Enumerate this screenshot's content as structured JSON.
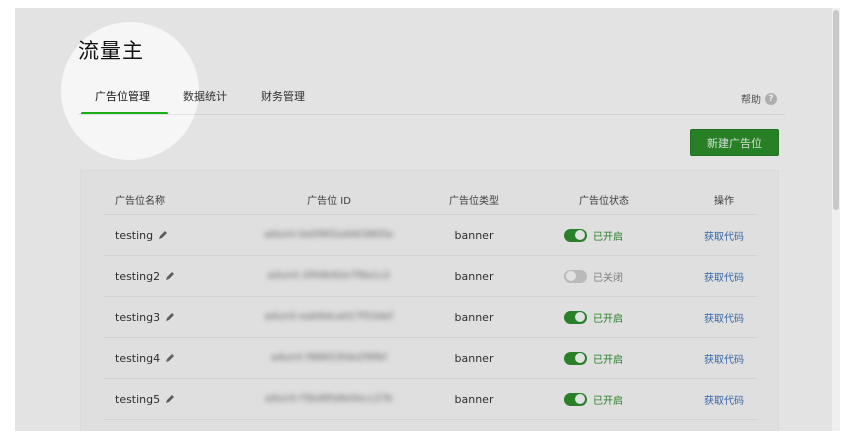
{
  "app": {
    "title": "流量主"
  },
  "tabs": [
    {
      "label": "广告位管理",
      "active": true
    },
    {
      "label": "数据统计",
      "active": false
    },
    {
      "label": "财务管理",
      "active": false
    }
  ],
  "help": {
    "label": "帮助",
    "icon": "question-icon"
  },
  "toolbar": {
    "new_button_label": "新建广告位"
  },
  "table": {
    "headers": [
      "广告位名称",
      "广告位 ID",
      "广告位类型",
      "广告位状态",
      "操作"
    ],
    "rows": [
      {
        "name": "testing",
        "id": "adunit-be0f6f2a4403805e",
        "type": "banner",
        "status": "已开启",
        "enabled": true,
        "action": "获取代码"
      },
      {
        "name": "testing2",
        "id": "adunit-2f04b92e7f8a1c2",
        "type": "banner",
        "status": "已关闭",
        "enabled": false,
        "action": "获取代码"
      },
      {
        "name": "testing3",
        "id": "adunit-eab9dca017f53def",
        "type": "banner",
        "status": "已开启",
        "enabled": true,
        "action": "获取代码"
      },
      {
        "name": "testing4",
        "id": "adunit-f88653fde2f9fbf",
        "type": "banner",
        "status": "已开启",
        "enabled": true,
        "action": "获取代码"
      },
      {
        "name": "testing5",
        "id": "adunit-f3bd8fa8e0ecc27b",
        "type": "banner",
        "status": "已开启",
        "enabled": true,
        "action": "获取代码"
      }
    ]
  },
  "colors": {
    "accent": "#1aad19",
    "button": "#2b8a2a",
    "link": "#3b6fb3"
  }
}
